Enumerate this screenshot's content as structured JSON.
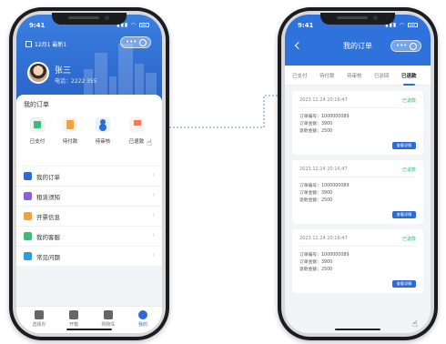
{
  "colors": {
    "primary": "#2c6bd8",
    "header": "#3a7fe0",
    "success": "#2bb673"
  },
  "left": {
    "status": {
      "time": "9:41"
    },
    "company": "12月1 最新1",
    "user": {
      "name": "张三",
      "phone": "电话：2222 355"
    },
    "orders_title": "我的订单",
    "order_entries": [
      {
        "label": "已支付",
        "icon": "paid-icon"
      },
      {
        "label": "待付款",
        "icon": "pending-payment-icon"
      },
      {
        "label": "待审核",
        "icon": "review-icon"
      },
      {
        "label": "已退款",
        "icon": "refund-icon"
      }
    ],
    "menu": [
      {
        "label": "我的订单",
        "icon": "order-icon",
        "color": "#2c6bd8"
      },
      {
        "label": "租赁须知",
        "icon": "notice-icon",
        "color": "#8f5fd6"
      },
      {
        "label": "开票信息",
        "icon": "invoice-icon",
        "color": "#f3a13e"
      },
      {
        "label": "我的客服",
        "icon": "service-icon",
        "color": "#3dbb7a"
      },
      {
        "label": "常见问题",
        "icon": "faq-icon",
        "color": "#2c9be0"
      }
    ],
    "tabs": [
      {
        "label": "选择办",
        "icon": "location-icon"
      },
      {
        "label": "开箱",
        "icon": "box-icon"
      },
      {
        "label": "购物车",
        "icon": "cart-icon"
      },
      {
        "label": "我的",
        "icon": "profile-icon"
      }
    ],
    "active_tab": 3
  },
  "right": {
    "status": {
      "time": "9:41"
    },
    "title": "我的订单",
    "tabs": [
      "已支付",
      "待付款",
      "待审核",
      "已驳回",
      "已退款"
    ],
    "active_tab": 4,
    "orders": [
      {
        "time": "2023.12.24 20:16:47",
        "status": "已退款",
        "number": "订单编号：1000000089",
        "amount": "订单金额：3900",
        "refund": "退款金额：2500",
        "button": "查看详情"
      },
      {
        "time": "2023.12.24 20:16:47",
        "status": "已退款",
        "number": "订单编号：1000000089",
        "amount": "订单金额：3900",
        "refund": "退款金额：2500",
        "button": "查看详情"
      },
      {
        "time": "2023.12.24 20:16:47",
        "status": "已退款",
        "number": "订单编号：1000000089",
        "amount": "订单金额：3900",
        "refund": "退款金额：2500",
        "button": "查看详情"
      }
    ]
  }
}
